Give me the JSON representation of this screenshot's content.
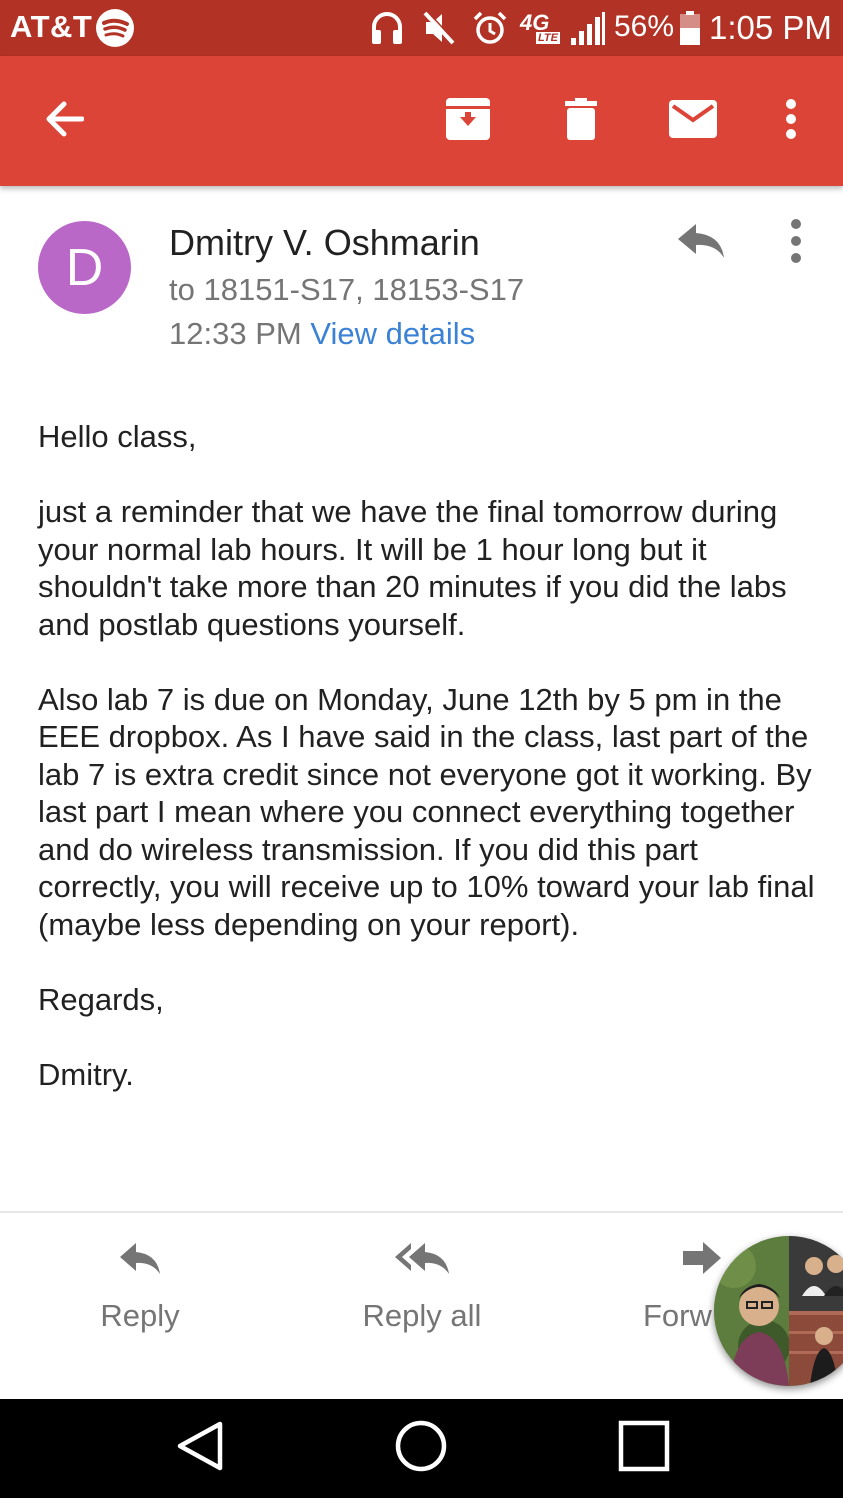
{
  "status_bar": {
    "carrier": "AT&T",
    "battery_percent": "56%",
    "time": "1:05 PM",
    "network": "4G",
    "network_sub": "LTE",
    "icons": [
      "spotify-icon",
      "headphones-icon",
      "mute-icon",
      "alarm-icon",
      "4g-lte-icon",
      "signal-icon",
      "battery-icon"
    ]
  },
  "toolbar": {
    "icons": [
      "back-arrow-icon",
      "archive-icon",
      "delete-icon",
      "mark-unread-icon",
      "more-vert-icon"
    ],
    "color": "#db4437"
  },
  "email": {
    "avatar_letter": "D",
    "avatar_color": "#ba68c8",
    "sender": "Dmitry V. Oshmarin",
    "recipients": "to 18151-S17, 18153-S17",
    "time": "12:33 PM",
    "details_link": "View details",
    "body": {
      "greeting": "Hello class,",
      "paragraph_1": "just a reminder that we have the final tomorrow during your normal lab hours. It will be 1 hour long but it shouldn't take more than 20 minutes if you did the labs and postlab questions yourself.",
      "paragraph_2": "Also lab 7 is due on Monday, June 12th by 5 pm in the EEE dropbox. As I have said in the class, last part of the lab 7 is extra credit since not everyone got it working. By last part I mean where you connect everything together and do wireless transmission. If you did this part correctly, you will receive up to 10% toward your lab final (maybe less depending on your report).",
      "closing": "Regards,",
      "signature": "Dmitry."
    }
  },
  "actions": {
    "reply": "Reply",
    "reply_all": "Reply all",
    "forward": "Forw"
  },
  "nav_bar": {
    "icons": [
      "back-triangle-icon",
      "home-circle-icon",
      "recents-square-icon"
    ]
  }
}
